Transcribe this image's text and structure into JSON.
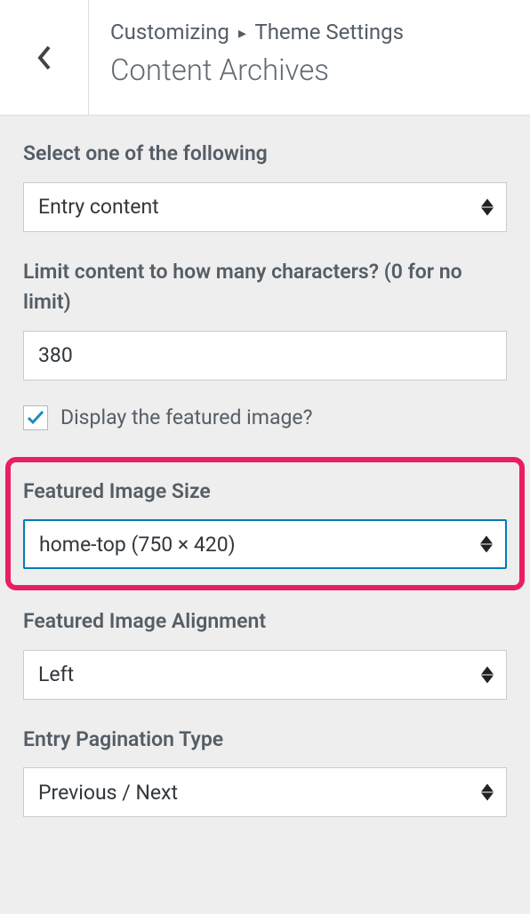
{
  "header": {
    "breadcrumb_parent": "Customizing",
    "breadcrumb_current": "Theme Settings",
    "title": "Content Archives"
  },
  "fields": {
    "content_type": {
      "label": "Select one of the following",
      "value": "Entry content"
    },
    "char_limit": {
      "label": "Limit content to how many characters? (0 for no limit)",
      "value": "380"
    },
    "display_featured": {
      "label": "Display the featured image?",
      "checked": true
    },
    "image_size": {
      "label": "Featured Image Size",
      "value": "home-top (750 × 420)"
    },
    "image_alignment": {
      "label": "Featured Image Alignment",
      "value": "Left"
    },
    "pagination": {
      "label": "Entry Pagination Type",
      "value": "Previous / Next"
    }
  }
}
